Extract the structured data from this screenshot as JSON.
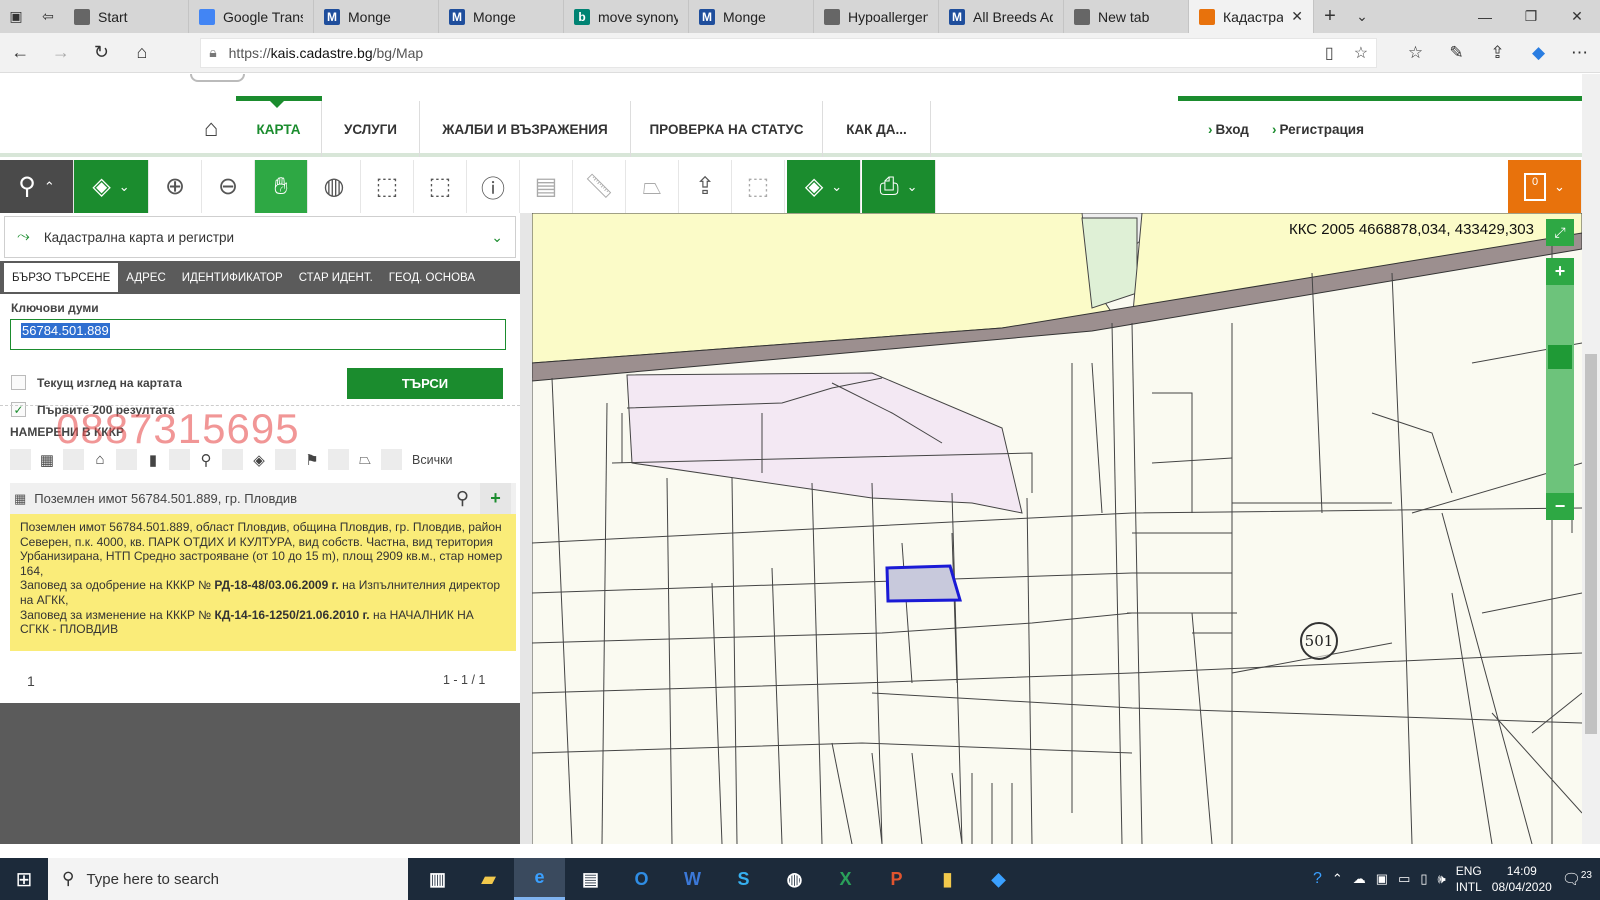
{
  "browser": {
    "tabs": [
      {
        "title": "Start",
        "icon": "start-page-icon",
        "color": "#666666"
      },
      {
        "title": "Google Transl",
        "icon": "google-translate-icon",
        "color": "#4285f4"
      },
      {
        "title": "Monge",
        "icon": "monge-m-icon",
        "color": "#1f4e9c"
      },
      {
        "title": "Monge",
        "icon": "monge-m-icon",
        "color": "#1f4e9c"
      },
      {
        "title": "move synonyr",
        "icon": "bing-icon",
        "color": "#008373"
      },
      {
        "title": "Monge",
        "icon": "monge-m-icon",
        "color": "#1f4e9c"
      },
      {
        "title": "Hypoallergeni",
        "icon": "page-icon",
        "color": "#666666"
      },
      {
        "title": "All Breeds Adı",
        "icon": "monge-m-icon",
        "color": "#1f4e9c"
      },
      {
        "title": "New tab",
        "icon": "new-tab-icon",
        "color": "#666666"
      },
      {
        "title": "Кадастра",
        "icon": "cadastre-icon",
        "color": "#e8720c"
      }
    ],
    "url_prefix": "https://",
    "url_domain": "kais.cadastre.bg",
    "url_path": "/bg/Map"
  },
  "site_nav": {
    "items": [
      "КАРТА",
      "УСЛУГИ",
      "ЖАЛБИ И ВЪЗРАЖЕНИЯ",
      "ПРОВЕРКА НА СТАТУС",
      "КАК ДА..."
    ],
    "login": "Вход",
    "register": "Регистрация"
  },
  "toolbar": {
    "orange_badge": "0"
  },
  "panel": {
    "layer": "Кадастрална карта и регистри",
    "tabs": [
      "БЪРЗО ТЪРСЕНЕ",
      "АДРЕС",
      "ИДЕНТИФИКАТОР",
      "СТАР ИДЕНТ.",
      "ГЕОД. ОСНОВА"
    ],
    "keywords_label": "Ключови думи",
    "keywords_value": "56784.501.889",
    "current_view_label": "Текущ изглед на картата",
    "first200_label": "Първите 200 резултата",
    "search_button": "ТЪРСИ",
    "found_label": "НАМЕРЕНИ В КККР",
    "watermark": "0887315695",
    "filter_all": "Всички",
    "result_title": "Поземлен имот 56784.501.889, гр. Пловдив",
    "result_line1": "Поземлен имот 56784.501.889, област Пловдив, община Пловдив, гр. Пловдив, район Северен, п.к. 4000, кв. ПАРК ОТДИХ И КУЛТУРА, вид собств. Частна, вид територия Урбанизирана, НТП Средно застрояване (от 10 до 15 m), площ 2909 кв.м., стар номер 164,",
    "result_l2_pre": "Заповед за одобрение на КККР № ",
    "result_l2_bold": "РД-18-48/03.06.2009 г.",
    "result_l2_post": " на Изпълнителния директор на АГКК,",
    "result_l3_pre": "Заповед за изменение на КККР № ",
    "result_l3_bold": "КД-14-16-1250/21.06.2010 г.",
    "result_l3_post": " на НАЧАЛНИК НА СГКК - ПЛОВДИВ",
    "page_number": "1",
    "page_count": "1 - 1 / 1"
  },
  "map": {
    "coords": "ККС 2005 4668878,034, 433429,303",
    "parcel_label": "501",
    "highlight_color": "#1a1ad6"
  },
  "taskbar": {
    "search_placeholder": "Type here to search",
    "lang1": "ENG",
    "lang2": "INTL",
    "time": "14:09",
    "date": "08/04/2020",
    "notifications": "23"
  }
}
